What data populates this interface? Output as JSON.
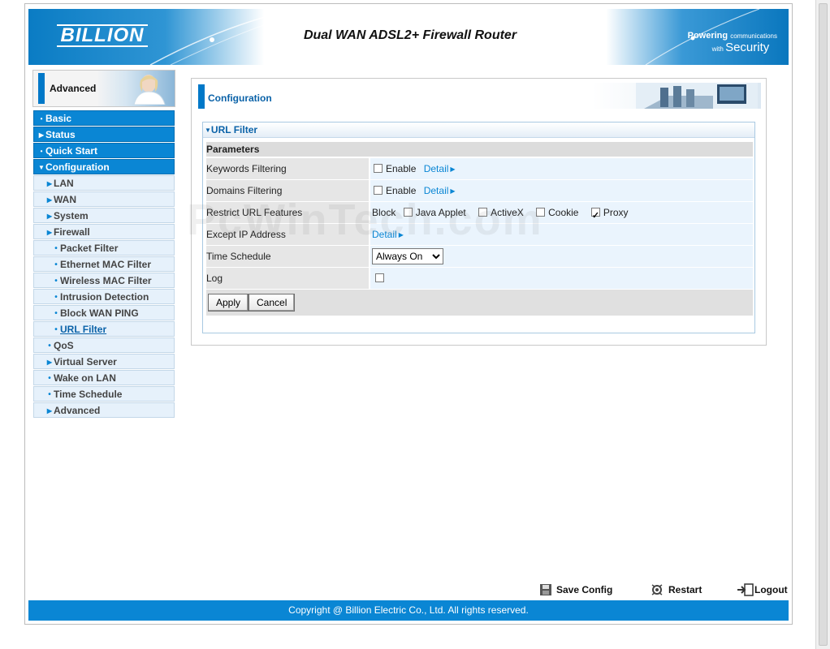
{
  "header": {
    "logo": "BILLION",
    "product_title": "Dual WAN ADSL2+ Firewall Router",
    "tagline_powering": "Powering",
    "tagline_communications": "communications",
    "tagline_with": "with",
    "tagline_security": "Security"
  },
  "mode": {
    "label": "Advanced"
  },
  "sidebar": {
    "basic": "Basic",
    "status": "Status",
    "quick_start": "Quick Start",
    "configuration": "Configuration",
    "lan": "LAN",
    "wan": "WAN",
    "system": "System",
    "firewall": "Firewall",
    "packet_filter": "Packet Filter",
    "ethernet_mac_filter": "Ethernet MAC Filter",
    "wireless_mac_filter": "Wireless MAC Filter",
    "intrusion_detection": "Intrusion Detection",
    "block_wan_ping": "Block WAN PING",
    "url_filter": "URL Filter",
    "qos": "QoS",
    "virtual_server": "Virtual Server",
    "wake_on_lan": "Wake on LAN",
    "time_schedule": "Time Schedule",
    "advanced": "Advanced"
  },
  "panel": {
    "title": "Configuration"
  },
  "url_filter": {
    "section_title": "URL Filter",
    "parameters": "Parameters",
    "keywords_label": "Keywords Filtering",
    "domains_label": "Domains Filtering",
    "restrict_label": "Restrict URL Features",
    "except_label": "Except IP Address",
    "schedule_label": "Time Schedule",
    "log_label": "Log",
    "enable": "Enable",
    "detail": "Detail",
    "block": "Block",
    "java_applet": "Java Applet",
    "activex": "ActiveX",
    "cookie": "Cookie",
    "proxy": "Proxy",
    "schedule_value": "Always On",
    "apply": "Apply",
    "cancel": "Cancel"
  },
  "footer": {
    "save_config": "Save Config",
    "restart": "Restart",
    "logout": "Logout",
    "copyright": "Copyright @ Billion Electric Co., Ltd. All rights reserved."
  },
  "watermark": "PcWinTech.com",
  "colors": {
    "accent": "#0a86d4",
    "header_blue": "#0a7cc4",
    "row_value_bg": "#eaf4fd"
  }
}
